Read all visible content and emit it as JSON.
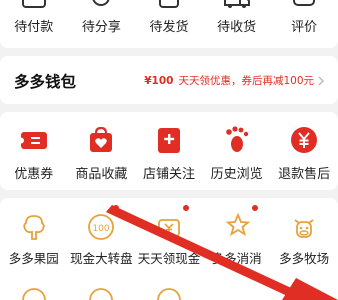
{
  "orders": {
    "items": [
      {
        "label": "待付款",
        "icon": "wallet-icon"
      },
      {
        "label": "待分享",
        "icon": "share-icon"
      },
      {
        "label": "待发货",
        "icon": "package-icon"
      },
      {
        "label": "待收货",
        "icon": "truck-icon"
      },
      {
        "label": "评价",
        "icon": "comment-icon"
      }
    ]
  },
  "wallet": {
    "title": "多多钱包",
    "promo_amount": "¥100",
    "promo_text": "天天领优惠，券后再减100元"
  },
  "services": {
    "items": [
      {
        "label": "优惠券",
        "icon": "coupon-icon"
      },
      {
        "label": "商品收藏",
        "icon": "heart-bag-icon"
      },
      {
        "label": "店铺关注",
        "icon": "store-plus-icon"
      },
      {
        "label": "历史浏览",
        "icon": "footprint-icon"
      },
      {
        "label": "退款售后",
        "icon": "yen-coin-icon"
      }
    ]
  },
  "apps": {
    "items": [
      {
        "label": "多多果园",
        "icon": "tree-icon"
      },
      {
        "label": "现金大转盘",
        "icon": "wheel-100-icon"
      },
      {
        "label": "天天领现金",
        "icon": "cash-icon"
      },
      {
        "label": "多多消消",
        "icon": "star-wand-icon"
      },
      {
        "label": "多多牧场",
        "icon": "cow-icon"
      }
    ]
  },
  "colors": {
    "accent": "#e02e24",
    "icon_stroke": "#333333",
    "app_icon": "#e8a23a",
    "background": "#f2f2f2"
  }
}
